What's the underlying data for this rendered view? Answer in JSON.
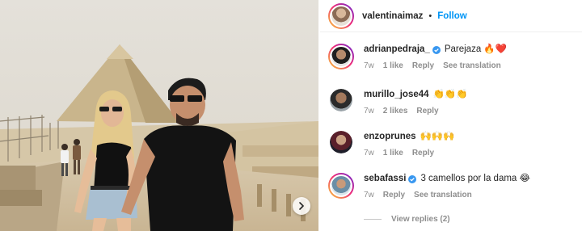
{
  "post": {
    "author": "valentinaimaz",
    "separator": "•",
    "follow_label": "Follow"
  },
  "comments": [
    {
      "username": "adrianpedraja_",
      "verified": true,
      "text": "Parejaza 🔥❤️",
      "age": "7w",
      "likes": "1 like",
      "reply_label": "Reply",
      "translate_label": "See translation"
    },
    {
      "username": "murillo_jose44",
      "verified": false,
      "text": "👏👏👏",
      "age": "7w",
      "likes": "2 likes",
      "reply_label": "Reply"
    },
    {
      "username": "enzoprunes",
      "verified": false,
      "text": "🙌🙌🙌",
      "age": "7w",
      "likes": "1 like",
      "reply_label": "Reply"
    },
    {
      "username": "sebafassi",
      "verified": true,
      "text": "3 camellos por la dama 😂",
      "age": "7w",
      "reply_label": "Reply",
      "translate_label": "See translation"
    }
  ],
  "view_replies": "View replies (2)",
  "colors": {
    "link_blue": "#0095f6",
    "verified_blue": "#3897f0",
    "meta_gray": "#8e8e8e",
    "text_dark": "#262626"
  },
  "icons": {
    "carousel": "chevron-right-icon",
    "verified": "verified-badge-icon"
  }
}
